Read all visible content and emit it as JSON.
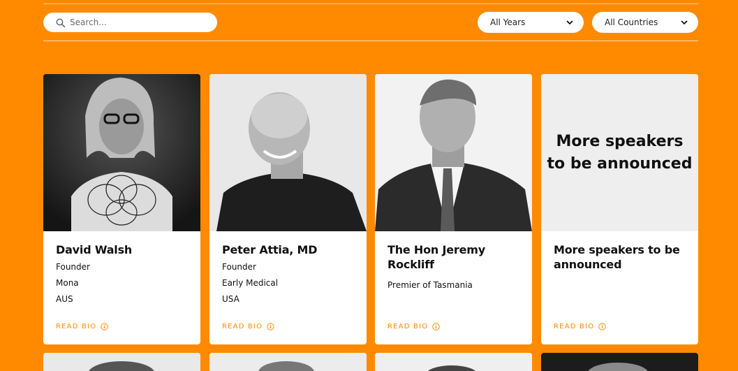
{
  "search": {
    "placeholder": "Search..."
  },
  "filters": {
    "years": "All Years",
    "countries": "All Countries"
  },
  "speakers": [
    {
      "name": "David Walsh",
      "lines": [
        "Founder",
        "Mona",
        "AUS"
      ],
      "cta": "READ BIO"
    },
    {
      "name": "Peter Attia, MD",
      "lines": [
        "Founder",
        "Early Medical",
        "USA"
      ],
      "cta": "READ BIO"
    },
    {
      "name": "The Hon Jeremy Rockliff",
      "lines": [
        "Premier of Tasmania"
      ],
      "cta": "READ BIO"
    },
    {
      "name": "More speakers to be announced",
      "lines": [],
      "cta": "READ BIO",
      "photo_text": "More speakers to be announced"
    }
  ],
  "colors": {
    "accent": "#ff8a00",
    "card_bg": "#ffffff",
    "placeholder_bg": "#eeeeee"
  }
}
